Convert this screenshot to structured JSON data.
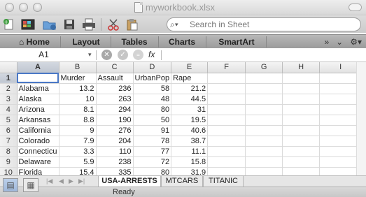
{
  "window": {
    "title": "myworkbook.xlsx"
  },
  "toolbar": {
    "search_placeholder": "Search in Sheet",
    "icons": [
      "new-workbook-icon",
      "templates-icon",
      "open-icon",
      "save-icon",
      "print-icon",
      "cut-icon",
      "paste-icon"
    ]
  },
  "ribbon": {
    "tabs": [
      {
        "label": "Home",
        "icon": "home-icon"
      },
      {
        "label": "Layout"
      },
      {
        "label": "Tables"
      },
      {
        "label": "Charts"
      },
      {
        "label": "SmartArt"
      }
    ]
  },
  "formula": {
    "cell_ref": "A1",
    "fx_label": "fx",
    "content": ""
  },
  "grid": {
    "columns": [
      "A",
      "B",
      "C",
      "D",
      "E",
      "F",
      "G",
      "H",
      "I"
    ],
    "rows": [
      {
        "n": "1",
        "a": "",
        "b": "Murder",
        "c": "Assault",
        "d": "UrbanPop",
        "e": "Rape"
      },
      {
        "n": "2",
        "a": "Alabama",
        "b": "13.2",
        "c": "236",
        "d": "58",
        "e": "21.2"
      },
      {
        "n": "3",
        "a": "Alaska",
        "b": "10",
        "c": "263",
        "d": "48",
        "e": "44.5"
      },
      {
        "n": "4",
        "a": "Arizona",
        "b": "8.1",
        "c": "294",
        "d": "80",
        "e": "31"
      },
      {
        "n": "5",
        "a": "Arkansas",
        "b": "8.8",
        "c": "190",
        "d": "50",
        "e": "19.5"
      },
      {
        "n": "6",
        "a": "California",
        "b": "9",
        "c": "276",
        "d": "91",
        "e": "40.6"
      },
      {
        "n": "7",
        "a": "Colorado",
        "b": "7.9",
        "c": "204",
        "d": "78",
        "e": "38.7"
      },
      {
        "n": "8",
        "a": "Connecticu",
        "b": "3.3",
        "c": "110",
        "d": "77",
        "e": "11.1"
      },
      {
        "n": "9",
        "a": "Delaware",
        "b": "5.9",
        "c": "238",
        "d": "72",
        "e": "15.8"
      },
      {
        "n": "10",
        "a": "Florida",
        "b": "15.4",
        "c": "335",
        "d": "80",
        "e": "31.9"
      }
    ]
  },
  "sheets": {
    "tabs": [
      {
        "label": "USA-ARRESTS",
        "active": true
      },
      {
        "label": "MTCARS"
      },
      {
        "label": "TITANIC"
      }
    ]
  },
  "status": {
    "text": "Ready"
  }
}
